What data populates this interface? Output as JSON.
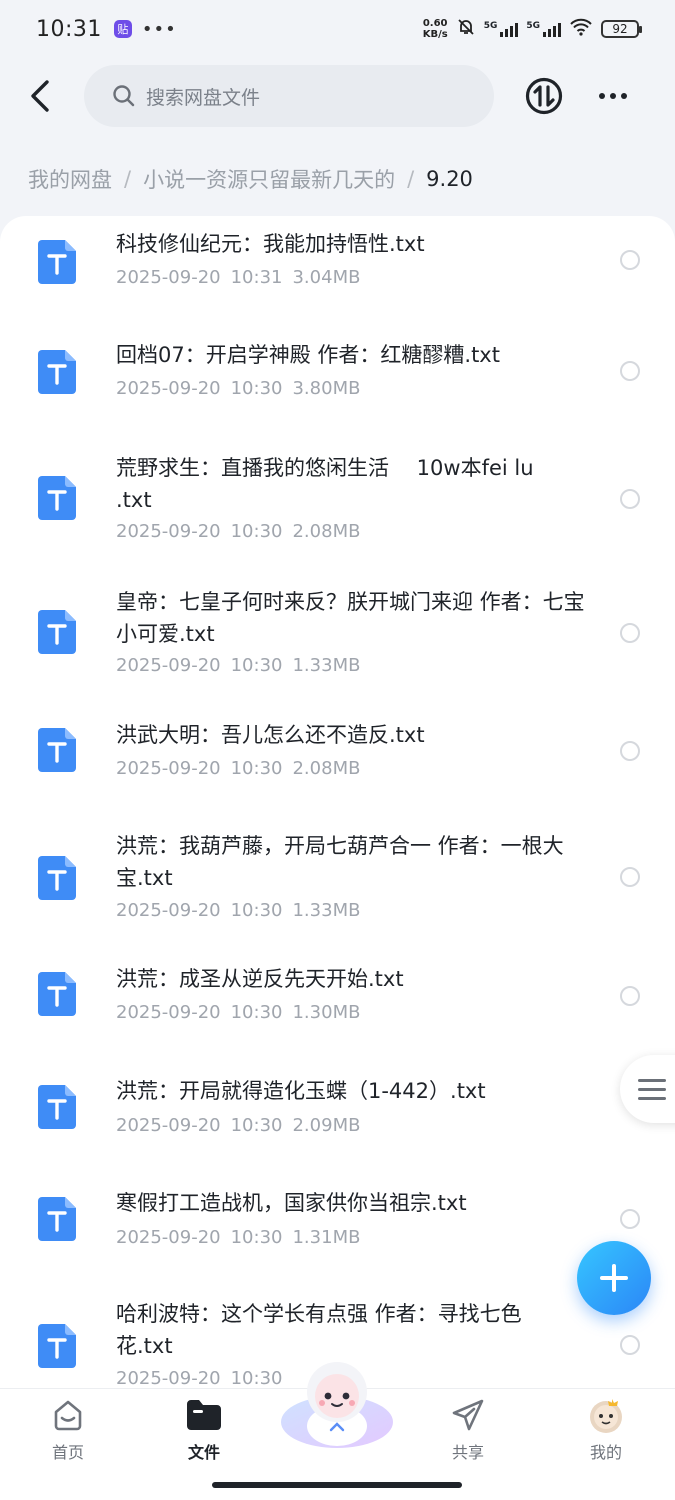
{
  "status_bar": {
    "time": "10:31",
    "app_badge": "贴",
    "dots": "•••",
    "net_speed_value": "0.60",
    "net_speed_unit": "KB/s",
    "signal_1_label": "5G",
    "signal_2_label": "5G",
    "battery": "92"
  },
  "header": {
    "search_placeholder": "搜索网盘文件"
  },
  "breadcrumb": {
    "items": [
      "我的网盘",
      "小说一资源只留最新几天的"
    ],
    "separator": "/",
    "current": "9.20"
  },
  "files": [
    {
      "name": "科技修仙纪元：我能加持悟性.txt",
      "date": "2025-09-20",
      "time": "10:31",
      "size": "3.04MB"
    },
    {
      "name": "回档07：开启学神殿 作者：红糖醪糟.txt",
      "date": "2025-09-20",
      "time": "10:30",
      "size": "3.80MB"
    },
    {
      "name": "荒野求生：直播我的悠闲生活　 10w本fei lu .txt",
      "date": "2025-09-20",
      "time": "10:30",
      "size": "2.08MB"
    },
    {
      "name": "皇帝：七皇子何时来反？朕开城门来迎 作者：七宝小可爱.txt",
      "date": "2025-09-20",
      "time": "10:30",
      "size": "1.33MB"
    },
    {
      "name": "洪武大明：吾儿怎么还不造反.txt",
      "date": "2025-09-20",
      "time": "10:30",
      "size": "2.08MB"
    },
    {
      "name": "洪荒：我葫芦藤，开局七葫芦合一 作者：一根大宝.txt",
      "date": "2025-09-20",
      "time": "10:30",
      "size": "1.33MB"
    },
    {
      "name": "洪荒：成圣从逆反先天开始.txt",
      "date": "2025-09-20",
      "time": "10:30",
      "size": "1.30MB"
    },
    {
      "name": "洪荒：开局就得造化玉蝶（1-442）.txt",
      "date": "2025-09-20",
      "time": "10:30",
      "size": "2.09MB"
    },
    {
      "name": "寒假打工造战机，国家供你当祖宗.txt",
      "date": "2025-09-20",
      "time": "10:30",
      "size": "1.31MB"
    },
    {
      "name": "哈利波特：这个学长有点强 作者：寻找七色花.txt",
      "date": "2025-09-20",
      "time": "10:30",
      "size": ""
    }
  ],
  "file_icon_letter": "T",
  "bottom_nav": {
    "home": "首页",
    "files": "文件",
    "share": "共享",
    "mine": "我的"
  },
  "colors": {
    "accent": "#2b86f7",
    "file_icon": "#3f8cf6",
    "muted_text": "#a0a5ad"
  }
}
